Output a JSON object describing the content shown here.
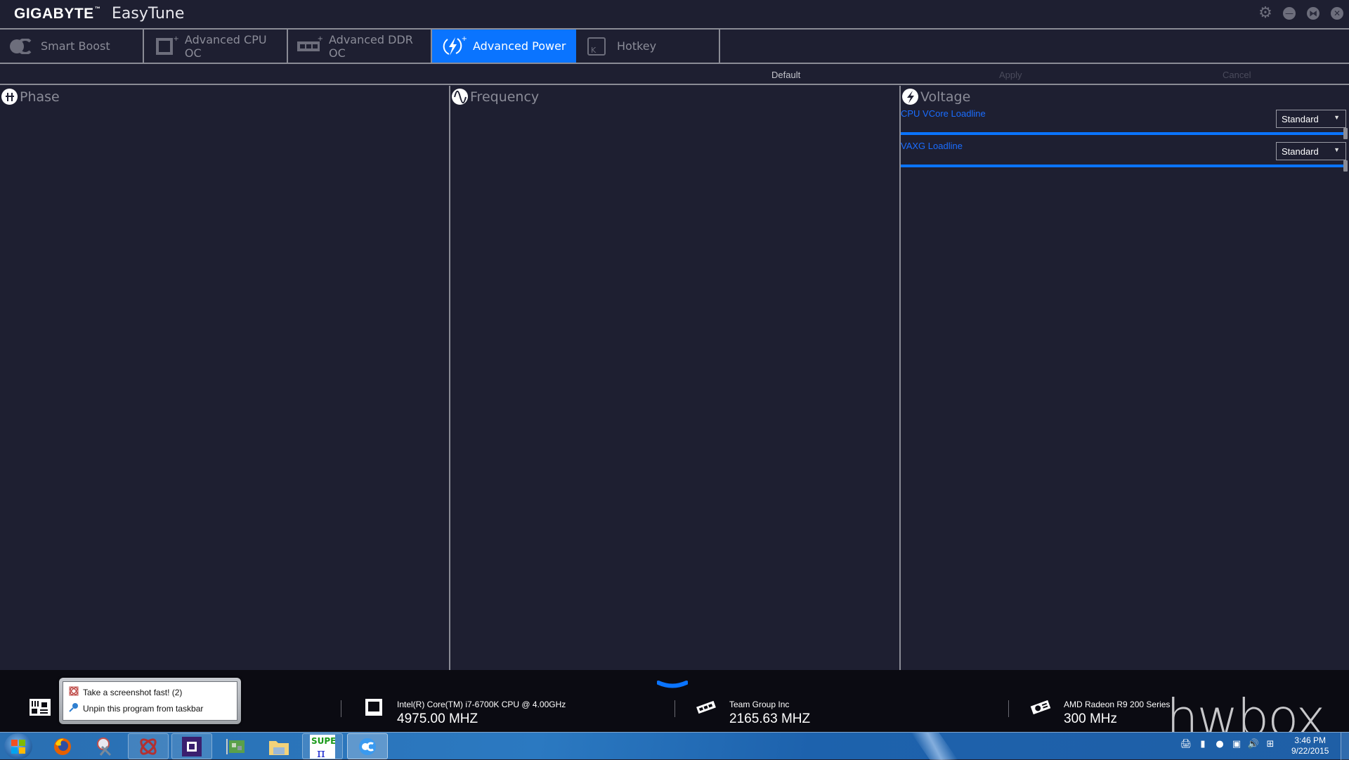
{
  "window": {
    "brand": "GIGABYTE",
    "app_name": "EasyTune",
    "controls": [
      {
        "name": "settings",
        "icon": "gear-icon",
        "glyph": "⚙"
      },
      {
        "name": "minimize",
        "icon": "minimize-icon",
        "glyph": "—"
      },
      {
        "name": "restore",
        "icon": "restore-icon",
        "glyph": "⧓"
      },
      {
        "name": "close",
        "icon": "close-icon",
        "glyph": "✕"
      }
    ]
  },
  "tabs": [
    {
      "label": "Smart Boost",
      "icon": "smart-boost-icon",
      "active": false,
      "has_plus": false
    },
    {
      "label": "Advanced CPU OC",
      "icon": "cpu-icon",
      "active": false,
      "has_plus": true
    },
    {
      "label": "Advanced DDR OC",
      "icon": "memory-icon",
      "active": false,
      "has_plus": true
    },
    {
      "label": "Advanced Power",
      "icon": "lightning-icon",
      "active": true,
      "has_plus": true
    },
    {
      "label": "Hotkey",
      "icon": "hotkey-icon",
      "active": false,
      "has_plus": false,
      "key_glyph": "K"
    }
  ],
  "actions": {
    "default": "Default",
    "apply": "Apply",
    "cancel": "Cancel"
  },
  "panels": {
    "phase": {
      "title": "Phase",
      "icon": "phase-icon"
    },
    "frequency": {
      "title": "Frequency",
      "icon": "sine-wave-icon"
    },
    "voltage": {
      "title": "Voltage",
      "icon": "lightning-icon",
      "settings": [
        {
          "label": "CPU VCore Loadline",
          "value": "Standard",
          "slider_fraction": 1.0
        },
        {
          "label": "VAXG Loadline",
          "value": "Standard",
          "slider_fraction": 1.0
        }
      ]
    }
  },
  "infobar": {
    "cpu": {
      "name": "Intel(R) Core(TM) i7-6700K CPU @ 4.00GHz",
      "value": "4975.00 MHZ"
    },
    "memory": {
      "name": "Team Group Inc",
      "value": "2165.63 MHZ"
    },
    "gpu": {
      "name": "AMD Radeon R9 200 Series",
      "value": "300 MHz"
    }
  },
  "jumplist": {
    "items": [
      {
        "label": "Take a screenshot fast! (2)",
        "icon": "screenshot-app-icon"
      },
      {
        "label": "Unpin this program from taskbar",
        "icon": "unpin-icon"
      }
    ]
  },
  "watermark": "hwbox",
  "taskbar": {
    "apps": [
      {
        "name": "firefox"
      },
      {
        "name": "snipping-tool"
      },
      {
        "name": "screenshot-tool"
      },
      {
        "name": "cpu-z"
      },
      {
        "name": "gpu-tool"
      },
      {
        "name": "file-explorer"
      },
      {
        "name": "super-pi"
      },
      {
        "name": "easytune"
      }
    ],
    "clock": {
      "time": "3:46 PM",
      "date": "9/22/2015"
    }
  },
  "colors": {
    "accent": "#0a74ff",
    "background": "#1e1f31",
    "label_blue": "#1a6dff",
    "muted_text": "#8b8c98",
    "border": "#8a8b95"
  }
}
